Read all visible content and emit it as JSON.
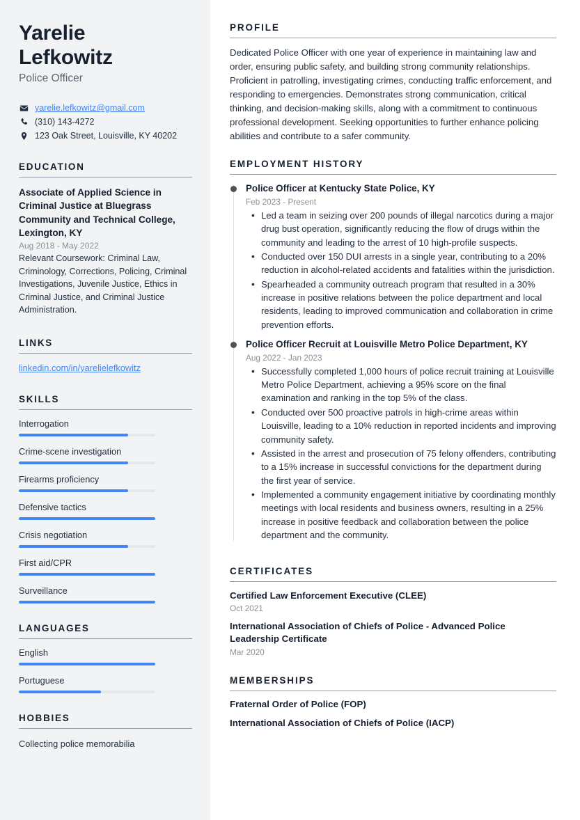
{
  "theme": {
    "accent": "#4285f4",
    "ink": "#16202e",
    "muted": "#8c9196",
    "sidebar_bg": "#f1f3f5"
  },
  "sidebar": {
    "first_name": "Yarelie",
    "last_name": "Lefkowitz",
    "job_title": "Police Officer",
    "contact": {
      "email": "yarelie.lefkowitz@gmail.com",
      "phone": "(310) 143-4272",
      "address": "123 Oak Street, Louisville, KY 40202"
    },
    "education": {
      "heading": "EDUCATION",
      "items": [
        {
          "title": "Associate of Applied Science in Criminal Justice at Bluegrass Community and Technical College, Lexington, KY",
          "date": "Aug 2018 - May 2022",
          "description": "Relevant Coursework: Criminal Law, Criminology, Corrections, Policing, Criminal Investigations, Juvenile Justice, Ethics in Criminal Justice, and Criminal Justice Administration."
        }
      ]
    },
    "links": {
      "heading": "LINKS",
      "items": [
        {
          "label": "linkedin.com/in/yarelielefkowitz"
        }
      ]
    },
    "skills": {
      "heading": "SKILLS",
      "items": [
        {
          "label": "Interrogation",
          "level": 80
        },
        {
          "label": "Crime-scene investigation",
          "level": 80
        },
        {
          "label": "Firearms proficiency",
          "level": 80
        },
        {
          "label": "Defensive tactics",
          "level": 100
        },
        {
          "label": "Crisis negotiation",
          "level": 80
        },
        {
          "label": "First aid/CPR",
          "level": 100
        },
        {
          "label": "Surveillance",
          "level": 100
        }
      ]
    },
    "languages": {
      "heading": "LANGUAGES",
      "items": [
        {
          "label": "English",
          "level": 100
        },
        {
          "label": "Portuguese",
          "level": 60
        }
      ]
    },
    "hobbies": {
      "heading": "HOBBIES",
      "items": [
        {
          "label": "Collecting police memorabilia"
        }
      ]
    }
  },
  "main": {
    "profile": {
      "heading": "PROFILE",
      "text": "Dedicated Police Officer with one year of experience in maintaining law and order, ensuring public safety, and building strong community relationships. Proficient in patrolling, investigating crimes, conducting traffic enforcement, and responding to emergencies. Demonstrates strong communication, critical thinking, and decision-making skills, along with a commitment to continuous professional development. Seeking opportunities to further enhance policing abilities and contribute to a safer community."
    },
    "employment": {
      "heading": "EMPLOYMENT HISTORY",
      "jobs": [
        {
          "title": "Police Officer at Kentucky State Police, KY",
          "date": "Feb 2023 - Present",
          "bullets": [
            "Led a team in seizing over 200 pounds of illegal narcotics during a major drug bust operation, significantly reducing the flow of drugs within the community and leading to the arrest of 10 high-profile suspects.",
            "Conducted over 150 DUI arrests in a single year, contributing to a 20% reduction in alcohol-related accidents and fatalities within the jurisdiction.",
            "Spearheaded a community outreach program that resulted in a 30% increase in positive relations between the police department and local residents, leading to improved communication and collaboration in crime prevention efforts."
          ]
        },
        {
          "title": "Police Officer Recruit at Louisville Metro Police Department, KY",
          "date": "Aug 2022 - Jan 2023",
          "bullets": [
            "Successfully completed 1,000 hours of police recruit training at Louisville Metro Police Department, achieving a 95% score on the final examination and ranking in the top 5% of the class.",
            "Conducted over 500 proactive patrols in high-crime areas within Louisville, leading to a 10% reduction in reported incidents and improving community safety.",
            "Assisted in the arrest and prosecution of 75 felony offenders, contributing to a 15% increase in successful convictions for the department during the first year of service.",
            "Implemented a community engagement initiative by coordinating monthly meetings with local residents and business owners, resulting in a 25% increase in positive feedback and collaboration between the police department and the community."
          ]
        }
      ]
    },
    "certificates": {
      "heading": "CERTIFICATES",
      "items": [
        {
          "title": "Certified Law Enforcement Executive (CLEE)",
          "date": "Oct 2021"
        },
        {
          "title": "International Association of Chiefs of Police - Advanced Police Leadership Certificate",
          "date": "Mar 2020"
        }
      ]
    },
    "memberships": {
      "heading": "MEMBERSHIPS",
      "items": [
        {
          "title": "Fraternal Order of Police (FOP)"
        },
        {
          "title": "International Association of Chiefs of Police (IACP)"
        }
      ]
    }
  }
}
